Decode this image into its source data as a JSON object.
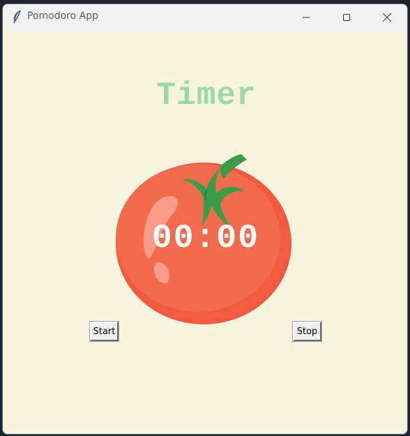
{
  "window": {
    "title": "Pomodoro App",
    "app_icon": "feather-icon",
    "controls": [
      "minimize-icon",
      "maximize-icon",
      "close-icon"
    ]
  },
  "main": {
    "heading": "Timer",
    "timer_text": "00:00",
    "image": "tomato-image",
    "start_label": "Start",
    "stop_label": "Stop"
  },
  "colors": {
    "background": "#f7f5e0",
    "heading": "#9bd9a5",
    "tomato": "#f26b4c",
    "leaf": "#3a9b48",
    "timer_text": "#ffffff"
  }
}
